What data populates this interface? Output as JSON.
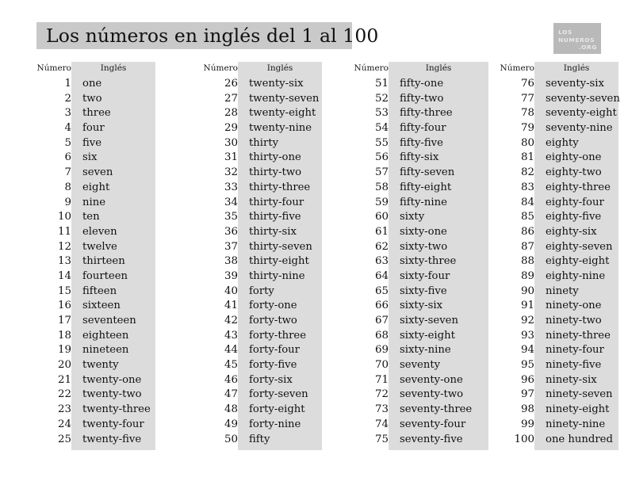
{
  "page": {
    "background_color": "#ffffff",
    "title": "Los números en inglés del 1 al 100",
    "title_band_color": "#c9c9c9",
    "band_color": "#dcdcdc",
    "text_color": "#111111"
  },
  "logo": {
    "line1": "LOS",
    "line2": "NUMEROS",
    "line3": ".ORG",
    "box_color": "#b9b9b9",
    "text_color": "#e8e8e8"
  },
  "headers": {
    "number": "Número",
    "english": "Inglés"
  },
  "columns": [
    {
      "rows": [
        {
          "n": "1",
          "en": "one"
        },
        {
          "n": "2",
          "en": "two"
        },
        {
          "n": "3",
          "en": "three"
        },
        {
          "n": "4",
          "en": "four"
        },
        {
          "n": "5",
          "en": "five"
        },
        {
          "n": "6",
          "en": "six"
        },
        {
          "n": "7",
          "en": "seven"
        },
        {
          "n": "8",
          "en": "eight"
        },
        {
          "n": "9",
          "en": "nine"
        },
        {
          "n": "10",
          "en": "ten"
        },
        {
          "n": "11",
          "en": "eleven"
        },
        {
          "n": "12",
          "en": "twelve"
        },
        {
          "n": "13",
          "en": "thirteen"
        },
        {
          "n": "14",
          "en": "fourteen"
        },
        {
          "n": "15",
          "en": "fifteen"
        },
        {
          "n": "16",
          "en": "sixteen"
        },
        {
          "n": "17",
          "en": "seventeen"
        },
        {
          "n": "18",
          "en": "eighteen"
        },
        {
          "n": "19",
          "en": "nineteen"
        },
        {
          "n": "20",
          "en": "twenty"
        },
        {
          "n": "21",
          "en": "twenty-one"
        },
        {
          "n": "22",
          "en": "twenty-two"
        },
        {
          "n": "23",
          "en": "twenty-three"
        },
        {
          "n": "24",
          "en": "twenty-four"
        },
        {
          "n": "25",
          "en": "twenty-five"
        }
      ]
    },
    {
      "rows": [
        {
          "n": "26",
          "en": "twenty-six"
        },
        {
          "n": "27",
          "en": "twenty-seven"
        },
        {
          "n": "28",
          "en": "twenty-eight"
        },
        {
          "n": "29",
          "en": "twenty-nine"
        },
        {
          "n": "30",
          "en": "thirty"
        },
        {
          "n": "31",
          "en": "thirty-one"
        },
        {
          "n": "32",
          "en": "thirty-two"
        },
        {
          "n": "33",
          "en": "thirty-three"
        },
        {
          "n": "34",
          "en": "thirty-four"
        },
        {
          "n": "35",
          "en": "thirty-five"
        },
        {
          "n": "36",
          "en": "thirty-six"
        },
        {
          "n": "37",
          "en": "thirty-seven"
        },
        {
          "n": "38",
          "en": "thirty-eight"
        },
        {
          "n": "39",
          "en": "thirty-nine"
        },
        {
          "n": "40",
          "en": "forty"
        },
        {
          "n": "41",
          "en": "forty-one"
        },
        {
          "n": "42",
          "en": "forty-two"
        },
        {
          "n": "43",
          "en": "forty-three"
        },
        {
          "n": "44",
          "en": "forty-four"
        },
        {
          "n": "45",
          "en": "forty-five"
        },
        {
          "n": "46",
          "en": "forty-six"
        },
        {
          "n": "47",
          "en": "forty-seven"
        },
        {
          "n": "48",
          "en": "forty-eight"
        },
        {
          "n": "49",
          "en": "forty-nine"
        },
        {
          "n": "50",
          "en": "fifty"
        }
      ]
    },
    {
      "rows": [
        {
          "n": "51",
          "en": "fifty-one"
        },
        {
          "n": "52",
          "en": "fifty-two"
        },
        {
          "n": "53",
          "en": "fifty-three"
        },
        {
          "n": "54",
          "en": "fifty-four"
        },
        {
          "n": "55",
          "en": "fifty-five"
        },
        {
          "n": "56",
          "en": "fifty-six"
        },
        {
          "n": "57",
          "en": "fifty-seven"
        },
        {
          "n": "58",
          "en": "fifty-eight"
        },
        {
          "n": "59",
          "en": "fifty-nine"
        },
        {
          "n": "60",
          "en": "sixty"
        },
        {
          "n": "61",
          "en": "sixty-one"
        },
        {
          "n": "62",
          "en": "sixty-two"
        },
        {
          "n": "63",
          "en": "sixty-three"
        },
        {
          "n": "64",
          "en": "sixty-four"
        },
        {
          "n": "65",
          "en": "sixty-five"
        },
        {
          "n": "66",
          "en": "sixty-six"
        },
        {
          "n": "67",
          "en": "sixty-seven"
        },
        {
          "n": "68",
          "en": "sixty-eight"
        },
        {
          "n": "69",
          "en": "sixty-nine"
        },
        {
          "n": "70",
          "en": "seventy"
        },
        {
          "n": "71",
          "en": "seventy-one"
        },
        {
          "n": "72",
          "en": "seventy-two"
        },
        {
          "n": "73",
          "en": "seventy-three"
        },
        {
          "n": "74",
          "en": "seventy-four"
        },
        {
          "n": "75",
          "en": "seventy-five"
        }
      ]
    },
    {
      "rows": [
        {
          "n": "76",
          "en": "seventy-six"
        },
        {
          "n": "77",
          "en": "seventy-seven"
        },
        {
          "n": "78",
          "en": "seventy-eight"
        },
        {
          "n": "79",
          "en": "seventy-nine"
        },
        {
          "n": "80",
          "en": "eighty"
        },
        {
          "n": "81",
          "en": "eighty-one"
        },
        {
          "n": "82",
          "en": "eighty-two"
        },
        {
          "n": "83",
          "en": "eighty-three"
        },
        {
          "n": "84",
          "en": "eighty-four"
        },
        {
          "n": "85",
          "en": "eighty-five"
        },
        {
          "n": "86",
          "en": "eighty-six"
        },
        {
          "n": "87",
          "en": "eighty-seven"
        },
        {
          "n": "88",
          "en": "eighty-eight"
        },
        {
          "n": "89",
          "en": "eighty-nine"
        },
        {
          "n": "90",
          "en": "ninety"
        },
        {
          "n": "91",
          "en": "ninety-one"
        },
        {
          "n": "92",
          "en": "ninety-two"
        },
        {
          "n": "93",
          "en": "ninety-three"
        },
        {
          "n": "94",
          "en": "ninety-four"
        },
        {
          "n": "95",
          "en": "ninety-five"
        },
        {
          "n": "96",
          "en": "ninety-six"
        },
        {
          "n": "97",
          "en": "ninety-seven"
        },
        {
          "n": "98",
          "en": "ninety-eight"
        },
        {
          "n": "99",
          "en": "ninety-nine"
        },
        {
          "n": "100",
          "en": "one hundred"
        }
      ]
    }
  ]
}
